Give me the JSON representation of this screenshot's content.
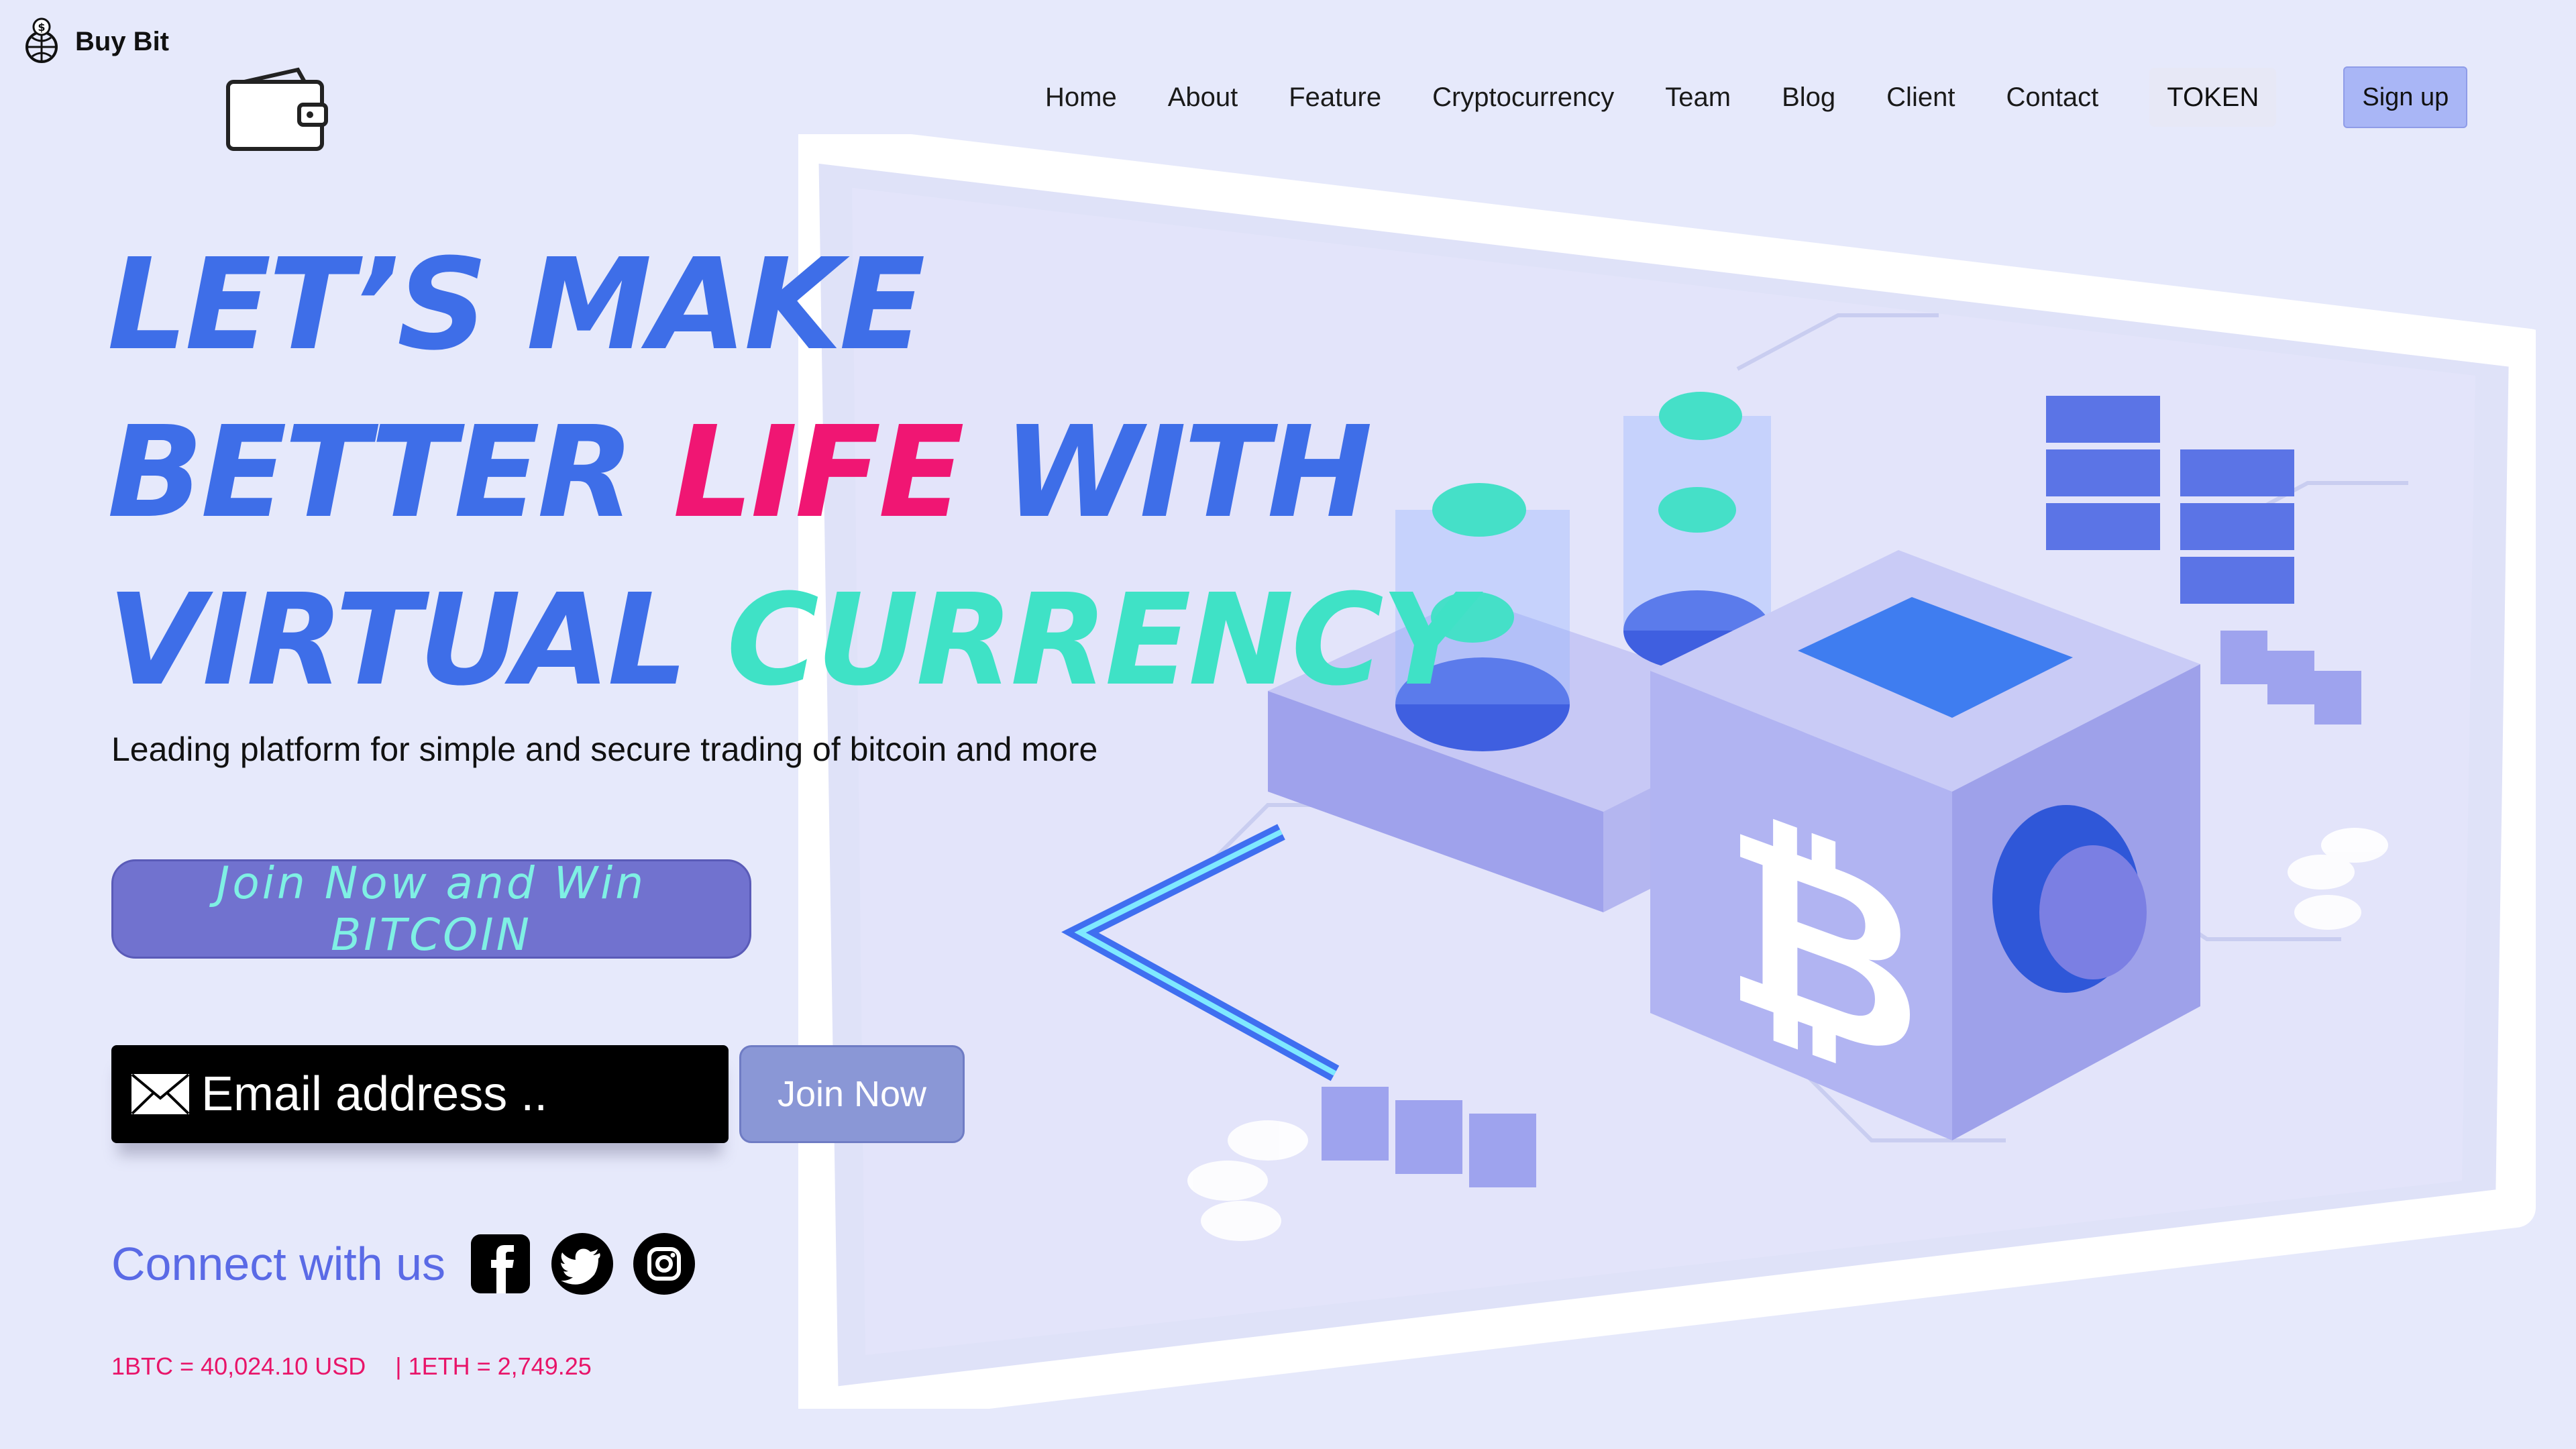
{
  "brand": {
    "name": "Buy Bit",
    "logo_icon": "globe-dollar-icon",
    "wallet_icon": "wallet-icon"
  },
  "nav": {
    "items": [
      "Home",
      "About",
      "Feature",
      "Cryptocurrency",
      "Team",
      "Blog",
      "Client",
      "Contact"
    ],
    "token_label": "TOKEN",
    "signup_label": "Sign up"
  },
  "hero": {
    "line1": "LET’S MAKE",
    "line2_a": "BETTER ",
    "line2_b": "LIFE",
    "line2_c": " WITH",
    "line3_a": "VIRTUAL ",
    "line3_b": "CURRENCY",
    "subtitle": "Leading platform for simple and secure trading of bitcoin and more"
  },
  "cta": {
    "bitcoin_button": "Join Now and Win BITCOIN"
  },
  "signup_form": {
    "email_placeholder": "Email address ..",
    "join_button": "Join Now"
  },
  "connect": {
    "label": "Connect with us",
    "icons": [
      "facebook-icon",
      "twitter-icon",
      "instagram-icon"
    ]
  },
  "rates": {
    "btc": "1BTC = 40,024.10 USD",
    "eth": "| 1ETH = 2,749.25"
  },
  "colors": {
    "background": "#e6e9fb",
    "headline_blue": "#3e6ee8",
    "headline_pink": "#f01673",
    "headline_teal": "#3fe2c6",
    "cta_purple": "#7172cf",
    "rates_pink": "#e81469",
    "connect_blue": "#5a6ae6"
  }
}
